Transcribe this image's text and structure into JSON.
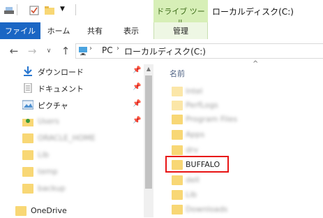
{
  "window": {
    "title": "ローカルディスク(C:)"
  },
  "ribbon": {
    "contextual_group": "ドライブ ツール",
    "tabs": [
      {
        "label": "ファイル"
      },
      {
        "label": "ホーム"
      },
      {
        "label": "共有"
      },
      {
        "label": "表示"
      },
      {
        "label": "管理"
      }
    ]
  },
  "address": {
    "crumbs": [
      {
        "label": "PC"
      },
      {
        "label": "ローカルディスク(C:)"
      }
    ]
  },
  "nav_pane": {
    "items": [
      {
        "label": "ダウンロード",
        "icon": "download-arrow-icon"
      },
      {
        "label": "ドキュメント",
        "icon": "document-icon"
      },
      {
        "label": "ピクチャ",
        "icon": "pictures-icon"
      },
      {
        "label": "Users",
        "icon": "user-folder-icon"
      },
      {
        "label": "ORACLE_HOME",
        "icon": "folder-icon"
      },
      {
        "label": "Lib",
        "icon": "folder-icon"
      },
      {
        "label": "temp",
        "icon": "folder-icon"
      },
      {
        "label": "backup",
        "icon": "folder-icon"
      },
      {
        "label": "OneDrive",
        "icon": "folder-icon"
      }
    ]
  },
  "content": {
    "column_name": "名前",
    "rows": [
      {
        "label": "Intel"
      },
      {
        "label": "PerfLogs"
      },
      {
        "label": "Program Files"
      },
      {
        "label": "Apps"
      },
      {
        "label": "drv"
      },
      {
        "label": "BUFFALO"
      },
      {
        "label": "dell"
      },
      {
        "label": "Lib"
      },
      {
        "label": "Downloads"
      }
    ]
  },
  "colors": {
    "file_tab": "#1a66c4",
    "contextual": "#d7efb7",
    "highlight": "#e81414",
    "folder": "#f8d775"
  }
}
